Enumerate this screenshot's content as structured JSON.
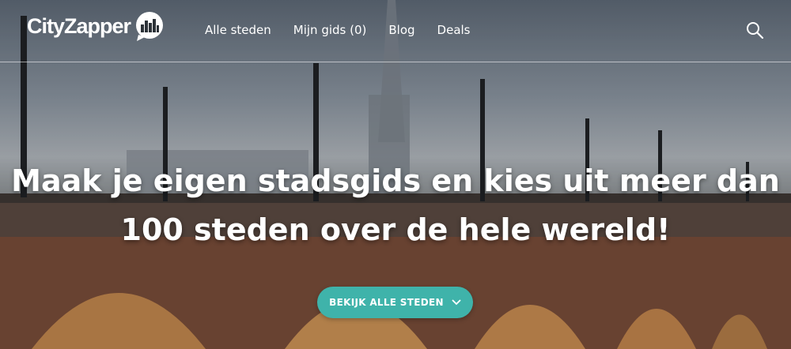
{
  "brand": {
    "name": "CityZapper"
  },
  "nav": {
    "items": [
      {
        "label": "Alle steden"
      },
      {
        "label": "Mijn gids (0)"
      },
      {
        "label": "Blog"
      },
      {
        "label": "Deals"
      }
    ]
  },
  "icons": {
    "search": "search-icon",
    "logo": "city-bubble-icon",
    "cta": "chevron-down-icon"
  },
  "hero": {
    "headline": "Maak je eigen stadsgids en kies uit meer dan 100 steden over de hele wereld!",
    "cta_label": "BEKIJK ALLE STEDEN"
  },
  "colors": {
    "accent": "#3fb3aa",
    "text": "#ffffff"
  }
}
